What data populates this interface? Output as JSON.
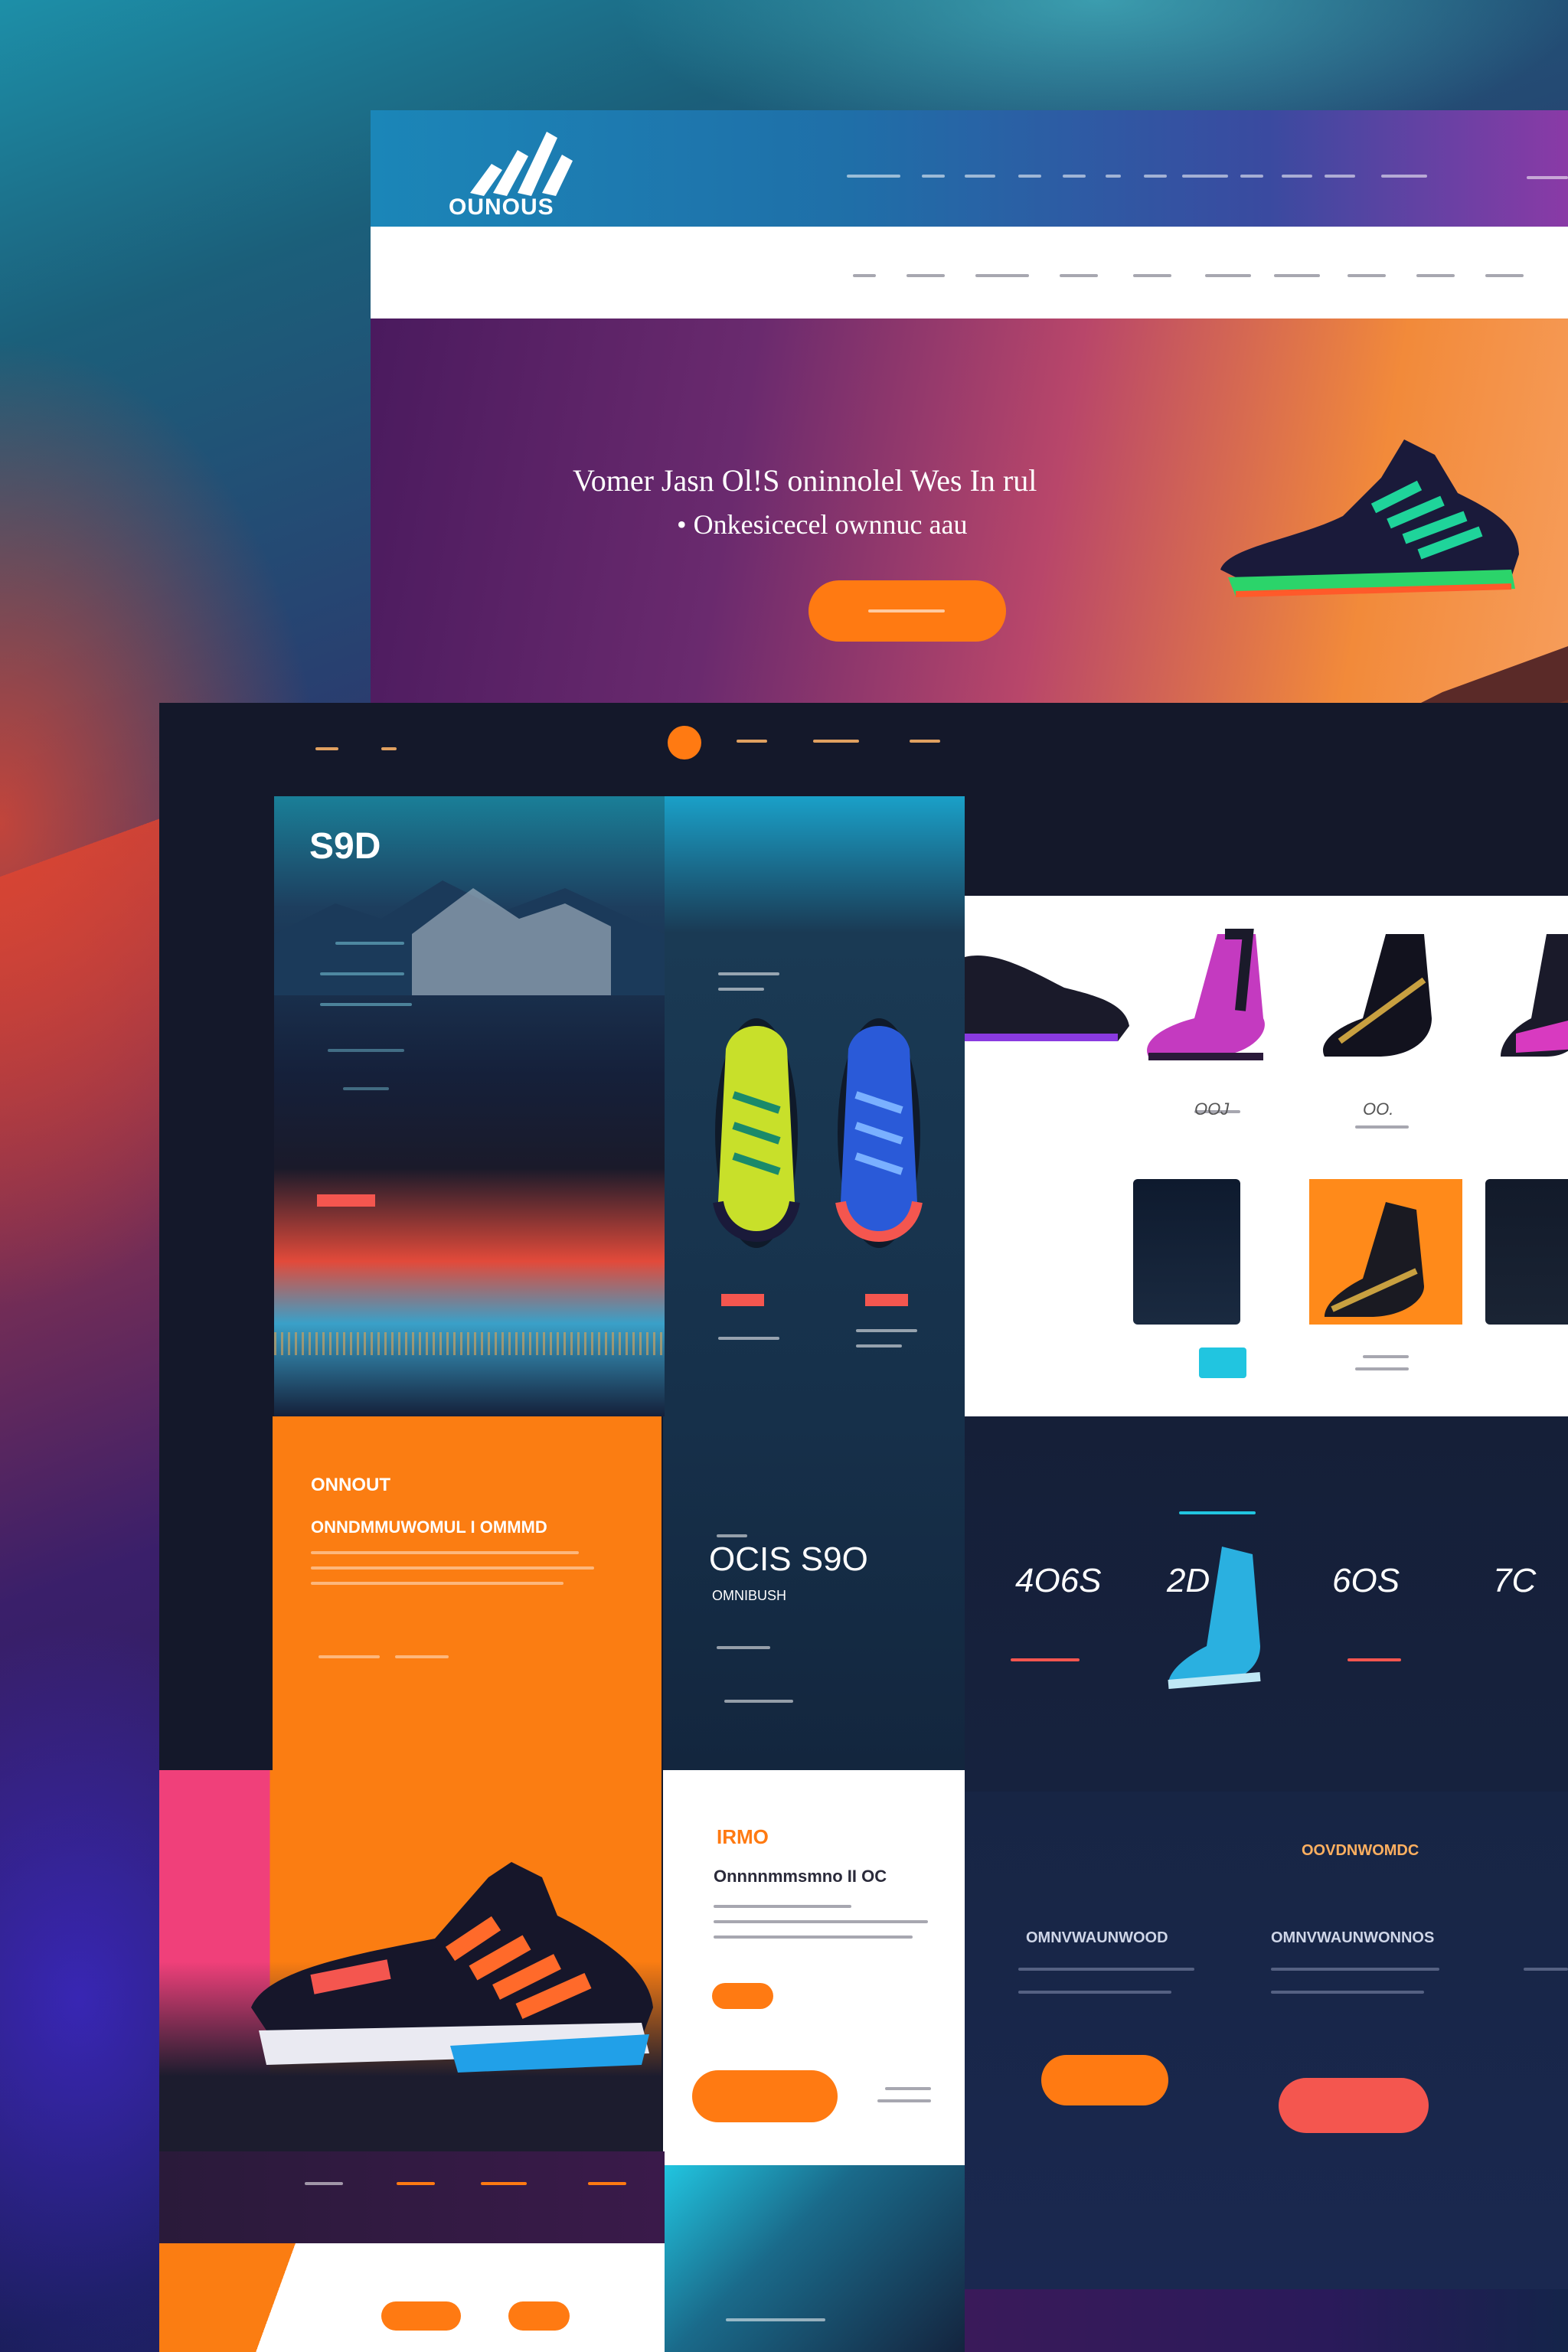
{
  "brand": {
    "logo_text": "OUNOUS"
  },
  "hero": {
    "headline": "Vomer Jasn Ol!S oninnolel Wes In rul",
    "subline": "• Onkesicecel ownnuc aau"
  },
  "panels": {
    "mountain_card": {
      "label": "S9D"
    },
    "orange_card": {
      "title": "ONNOUT",
      "subtitle": "ONNDMMUWOMUL I OMMMD"
    },
    "dark_card": {
      "price": "OCIS S9O",
      "caption": "OMNIBUSH"
    },
    "stats": [
      {
        "value": "4O6S"
      },
      {
        "value": "2D"
      },
      {
        "value": "6OS"
      },
      {
        "value": "7C"
      }
    ],
    "product_prices": [
      {
        "value": "OOJ"
      },
      {
        "value": "OO."
      }
    ],
    "promo_card": {
      "title": "IRMO",
      "subtitle": "Onnnnmmsmno II OC"
    },
    "info_blocks": [
      {
        "title": "OOVDNWOMDC"
      },
      {
        "title": "OMNVWAUNWOOD"
      },
      {
        "title": "OMNVWAUNWONNOS"
      }
    ]
  },
  "colors": {
    "accent": "#ff7a12",
    "coral": "#f4564f",
    "navy": "#14213d",
    "cyan": "#21c5e0"
  },
  "icons": [
    "brand-logo-icon",
    "sneaker-icon",
    "orange-dot-icon"
  ]
}
